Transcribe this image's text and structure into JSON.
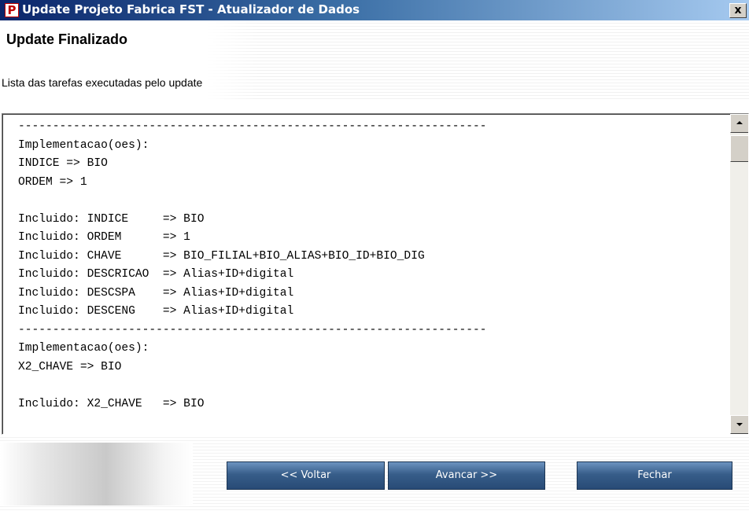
{
  "window": {
    "title": "Update Projeto Fabrica FST - Atualizador de Dados",
    "icon_letter": "P",
    "close_label": "x"
  },
  "header": {
    "title": "Update Finalizado",
    "subtitle": "Lista das tarefas executadas pelo update"
  },
  "log": {
    "lines": [
      "--------------------------------------------------------------------",
      "Implementacao(oes):",
      "INDICE => BIO",
      "ORDEM => 1",
      "",
      "Incluido: INDICE     => BIO",
      "Incluido: ORDEM      => 1",
      "Incluido: CHAVE      => BIO_FILIAL+BIO_ALIAS+BIO_ID+BIO_DIG",
      "Incluido: DESCRICAO  => Alias+ID+digital",
      "Incluido: DESCSPA    => Alias+ID+digital",
      "Incluido: DESCENG    => Alias+ID+digital",
      "--------------------------------------------------------------------",
      "Implementacao(oes):",
      "X2_CHAVE => BIO",
      "",
      "Incluido: X2_CHAVE   => BIO"
    ]
  },
  "buttons": {
    "back": "<< Voltar",
    "next": "Avancar >>",
    "close": "Fechar"
  },
  "colors": {
    "titlebar_start": "#0a246a",
    "button_blue": "#375d89"
  }
}
